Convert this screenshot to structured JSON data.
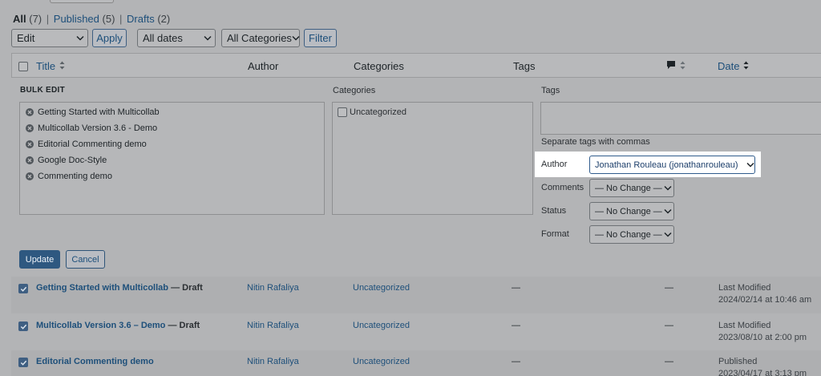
{
  "filters": {
    "all_label": "All",
    "all_count": "(7)",
    "published_label": "Published",
    "published_count": "(5)",
    "drafts_label": "Drafts",
    "drafts_count": "(2)",
    "separator": "|"
  },
  "toolbar": {
    "bulk_action": "Edit",
    "apply": "Apply",
    "dates": "All dates",
    "categories": "All Categories",
    "filter": "Filter"
  },
  "columns": {
    "title": "Title",
    "author": "Author",
    "categories": "Categories",
    "tags": "Tags",
    "date": "Date"
  },
  "bulk_edit": {
    "heading": "BULK EDIT",
    "posts": [
      "Getting Started with Multicollab",
      "Multicollab Version 3.6 - Demo",
      "Editorial Commenting demo",
      "Google Doc-Style",
      "Commenting demo"
    ],
    "categories_label": "Categories",
    "category_option": "Uncategorized",
    "tags_label": "Tags",
    "tags_hint": "Separate tags with commas",
    "author_label": "Author",
    "author_value": "Jonathan Rouleau (jonathanrouleau)",
    "comments_label": "Comments",
    "comments_value": "— No Change —",
    "status_label": "Status",
    "status_value": "— No Change —",
    "format_label": "Format",
    "format_value": "— No Change —",
    "update": "Update",
    "cancel": "Cancel"
  },
  "rows": [
    {
      "title": "Getting Started with Multicollab",
      "state": "— Draft",
      "author": "Nitin Rafaliya",
      "category": "Uncategorized",
      "tags": "—",
      "comments": "—",
      "date_status": "Last Modified",
      "date": "2024/02/14 at 10:46 am"
    },
    {
      "title": "Multicollab Version 3.6 – Demo",
      "state": "— Draft",
      "author": "Nitin Rafaliya",
      "category": "Uncategorized",
      "tags": "—",
      "comments": "—",
      "date_status": "Last Modified",
      "date": "2023/08/10 at 2:00 pm"
    },
    {
      "title": "Editorial Commenting demo",
      "state": "",
      "author": "Nitin Rafaliya",
      "category": "Uncategorized",
      "tags": "—",
      "comments": "—",
      "date_status": "Published",
      "date": "2023/04/17 at 3:13 pm"
    }
  ]
}
